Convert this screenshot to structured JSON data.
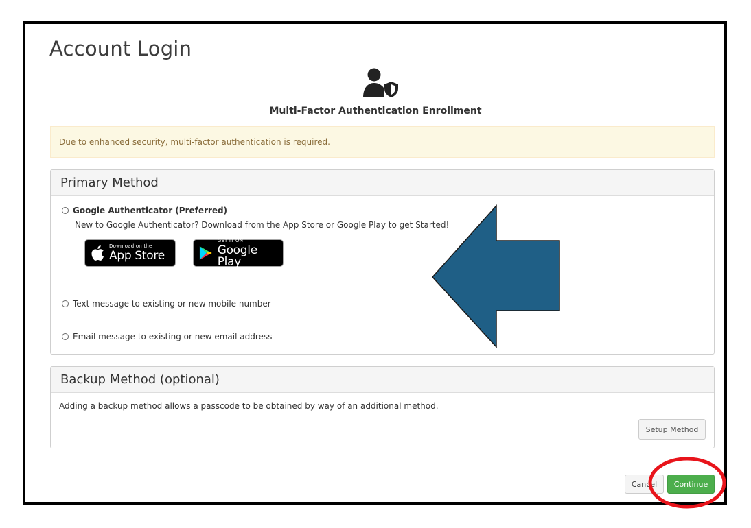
{
  "page": {
    "title": "Account Login",
    "mfa_heading": "Multi-Factor Authentication Enrollment",
    "alert_text": "Due to enhanced security, multi-factor authentication is required."
  },
  "primary_method": {
    "heading": "Primary Method",
    "options": [
      {
        "label": "Google Authenticator (Preferred)",
        "description": "New to Google Authenticator? Download from the App Store or Google Play to get Started!",
        "selected": false
      },
      {
        "label": "Text message to existing or new mobile number",
        "selected": false
      },
      {
        "label": "Email message to existing or new email address",
        "selected": false
      }
    ],
    "stores": {
      "app_store": {
        "small": "Download on the",
        "big": "App Store",
        "icon": "apple-icon"
      },
      "google_play": {
        "small": "GET IT ON",
        "big": "Google Play",
        "icon": "google-play-icon"
      }
    }
  },
  "backup_method": {
    "heading": "Backup Method (optional)",
    "description": "Adding a backup method allows a passcode to be obtained by way of an additional method.",
    "setup_label": "Setup Method"
  },
  "actions": {
    "cancel_label": "Cancel",
    "continue_label": "Continue"
  },
  "colors": {
    "alert_bg": "#fcf8e3",
    "alert_text": "#8a6d3b",
    "continue_bg": "#4cae4c",
    "arrow_fill": "#1f5f86",
    "highlight_circle": "#e8141b"
  },
  "icons": [
    "user-shield-icon",
    "apple-icon",
    "google-play-icon",
    "radio-icon"
  ]
}
